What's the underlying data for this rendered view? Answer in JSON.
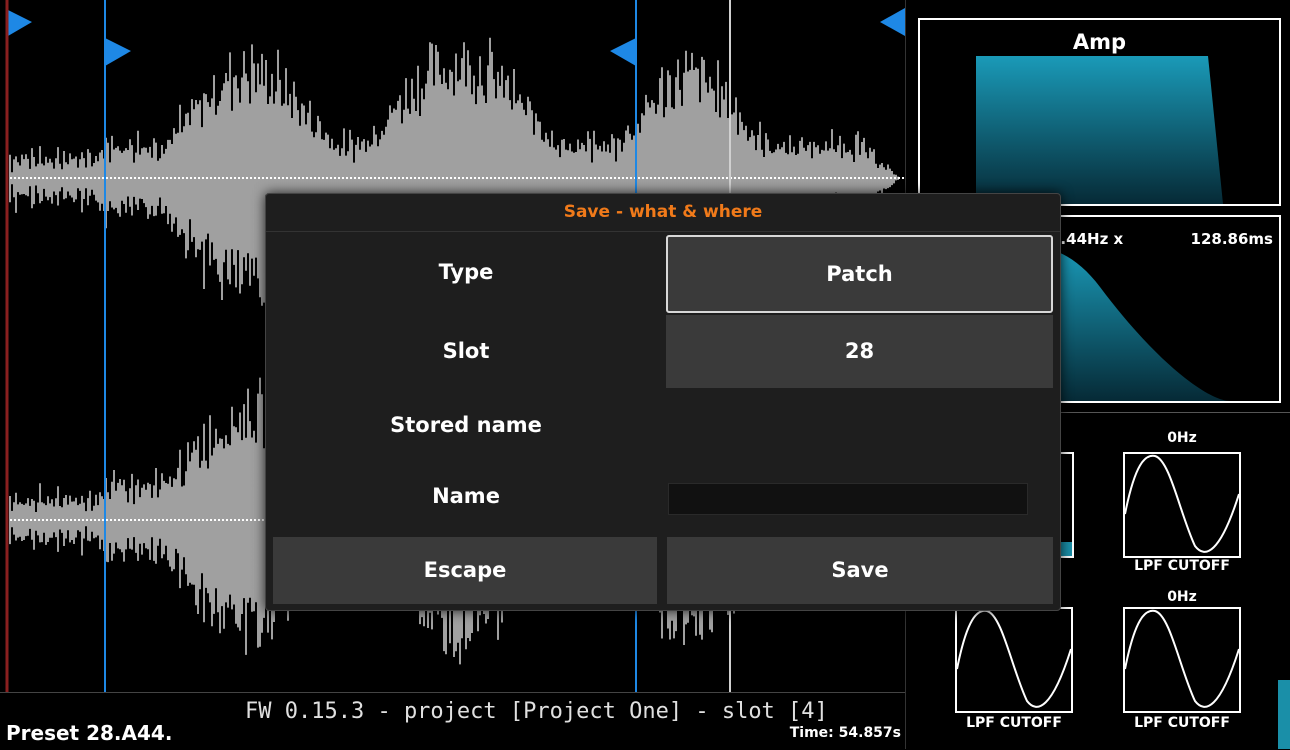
{
  "footer": {
    "fw_line": "FW 0.15.3 - project [Project One] - slot [4]",
    "preset": "Preset 28.A44.",
    "time": "Time: 54.857s"
  },
  "right_panel": {
    "amp_title": "Amp",
    "lfo_rate": "8.44Hz x",
    "lfo_time": "128.86ms",
    "mod1_top": "0Hz",
    "mod1_bottom": "LPF CUTOFF",
    "mod2_top": "0Hz",
    "mod3_bottom": "LPF CUTOFF",
    "mod4_bottom": "LPF CUTOFF"
  },
  "dialog": {
    "title": "Save - what & where",
    "type_label": "Type",
    "type_value": "Patch",
    "slot_label": "Slot",
    "slot_value": "28",
    "stored_name_label": "Stored name",
    "stored_name_value": "",
    "name_label": "Name",
    "name_value": "",
    "escape_label": "Escape",
    "save_label": "Save"
  },
  "colors": {
    "accent_orange": "#f07a1a",
    "marker_blue": "#1e88e5",
    "envelope_teal": "#1a9ab8",
    "waveform_gray": "#c8c8c8"
  }
}
